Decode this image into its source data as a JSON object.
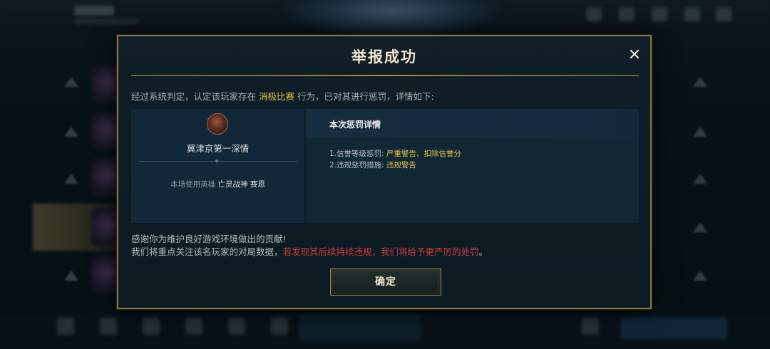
{
  "dialog": {
    "title": "举报成功",
    "close_icon": "close-icon",
    "verdict_prefix": "经过系统判定，认定该玩家存在 ",
    "verdict_highlight": "消极比赛",
    "verdict_suffix": " 行为，已对其进行惩罚，详情如下:",
    "player": {
      "name": "冀津京第一深情",
      "hero_prefix": "本场使用英雄 ",
      "hero_name": "亡灵战神 赛恩"
    },
    "penalty": {
      "title": "本次惩罚详情",
      "line1_label": "1.信誉等级惩罚: ",
      "line1_value": "严重警告、扣除信誉分",
      "line2_label": "2.违规惩罚措施: ",
      "line2_value": "违规警告"
    },
    "thanks_line1": "感谢你为维护良好游戏环境做出的贡献!",
    "thanks_line2_prefix": "我们将重点关注该名玩家的对局数据，",
    "thanks_line2_warning": "若发现其后续持续违规，我们将给予更严厉的处罚",
    "thanks_line2_suffix": "。",
    "confirm_label": "确定"
  },
  "colors": {
    "accent_gold": "#e6c14a",
    "warning_red": "#c73c3c",
    "frame_gold": "#8a7440"
  }
}
